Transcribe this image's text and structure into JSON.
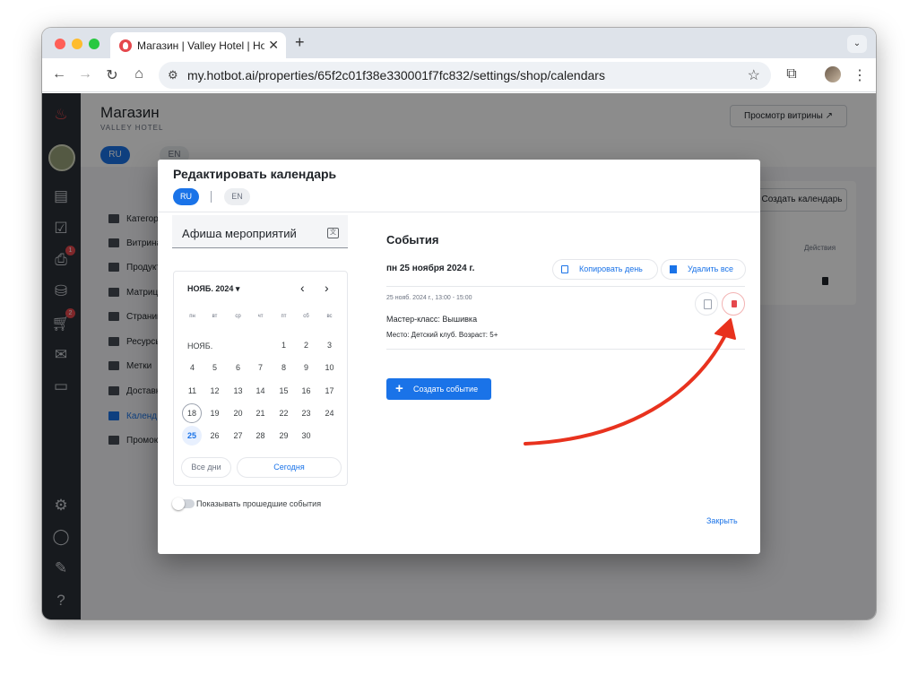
{
  "browser": {
    "tab_title": "Магазин | Valley Hotel | Hotbot",
    "tab_close": "✕",
    "new_tab": "+",
    "url": "my.hotbot.ai/properties/65f2c01f38e330001f7fc832/settings/shop/calendars",
    "icons": [
      "back-icon",
      "forward-icon",
      "reload-icon",
      "home-icon",
      "star-icon",
      "extensions-icon",
      "profile-avatar",
      "menu-icon"
    ]
  },
  "page": {
    "title": "Магазин",
    "subtitle": "VALLEY HOTEL",
    "preview_button": "Просмотр витрины ↗",
    "lang_ru": "RU",
    "lang_en": "EN",
    "create_calendar": "Создать календарь",
    "actions_header": "Действия",
    "menu": [
      {
        "label": "Категор"
      },
      {
        "label": "Витрина"
      },
      {
        "label": "Продукт"
      },
      {
        "label": "Матрица"
      },
      {
        "label": "Страниц"
      },
      {
        "label": "Ресурсы"
      },
      {
        "label": "Метки"
      },
      {
        "label": "Доставк"
      },
      {
        "label": "Календ"
      },
      {
        "label": "Промок"
      }
    ],
    "nav_badges": [
      "1",
      "2"
    ]
  },
  "modal": {
    "title": "Редактировать календарь",
    "lang_ru": "RU",
    "lang_en": "EN",
    "calendar_name": "Афиша мероприятий",
    "calendar": {
      "month_label": "НОЯБ. 2024",
      "month_short": "НОЯБ.",
      "weekdays": [
        "пн",
        "вт",
        "ср",
        "чт",
        "пт",
        "сб",
        "вс"
      ],
      "days": [
        [
          "",
          "",
          "",
          "",
          "1",
          "2",
          "3"
        ],
        [
          "4",
          "5",
          "6",
          "7",
          "8",
          "9",
          "10"
        ],
        [
          "11",
          "12",
          "13",
          "14",
          "15",
          "16",
          "17"
        ],
        [
          "18",
          "19",
          "20",
          "21",
          "22",
          "23",
          "24"
        ],
        [
          "25",
          "26",
          "27",
          "28",
          "29",
          "30",
          ""
        ]
      ],
      "today": "18",
      "selected": "25",
      "all_days": "Все дни",
      "today_button": "Сегодня"
    },
    "show_past_label": "Показывать прошедшие события",
    "events_title": "События",
    "day_header": "пн  25 ноября 2024 г.",
    "copy_day": "Копировать день",
    "delete_all": "Удалить все",
    "event": {
      "time": "25 нояб. 2024 г., 13:00 - 15:00",
      "title": "Мастер-класс: Вышивка",
      "place": "Место: Детский клуб. Возраст: 5+"
    },
    "create_event": "Создать событие",
    "close": "Закрыть"
  },
  "colors": {
    "accent": "#1a73e8",
    "danger": "#e5484d",
    "annotation_arrow": "#e8321e"
  }
}
